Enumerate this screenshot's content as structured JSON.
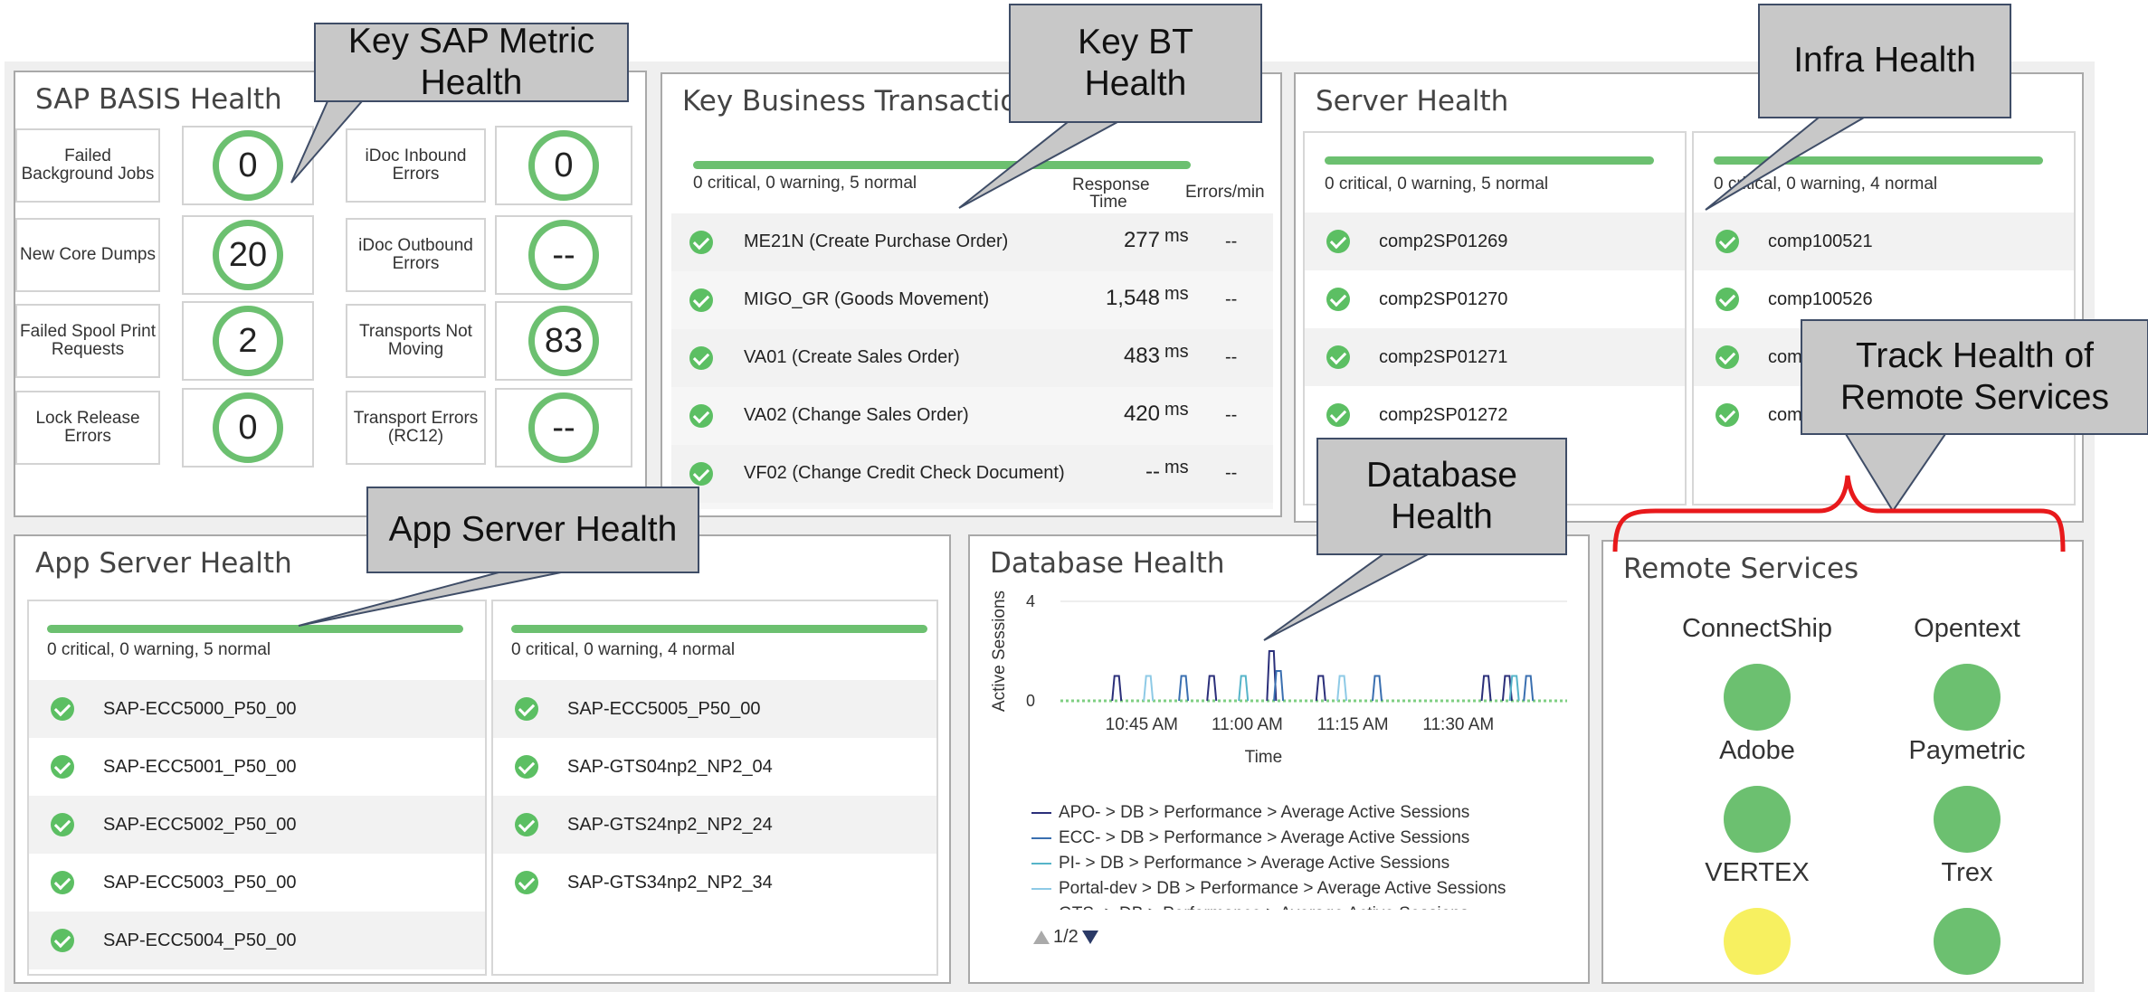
{
  "basis": {
    "title": "SAP BASIS Health",
    "metrics_left": [
      {
        "label": "Failed Background Jobs",
        "value": "0"
      },
      {
        "label": "New Core Dumps",
        "value": "20"
      },
      {
        "label": "Failed Spool Print Requests",
        "value": "2"
      },
      {
        "label": "Lock Release Errors",
        "value": "0"
      }
    ],
    "metrics_right": [
      {
        "label": "iDoc Inbound Errors",
        "value": "0"
      },
      {
        "label": "iDoc Outbound Errors",
        "value": "--"
      },
      {
        "label": "Transports Not Moving",
        "value": "83"
      },
      {
        "label": "Transport Errors (RC12)",
        "value": "--"
      }
    ]
  },
  "bt": {
    "title": "Key Business Transaction H",
    "summary": "0 critical, 0 warning, 5 normal",
    "col_response": "Response Time",
    "col_errors": "Errors/min",
    "rows": [
      {
        "name": "ME21N (Create Purchase Order)",
        "value": "277",
        "unit": "ms",
        "errors": "--"
      },
      {
        "name": "MIGO_GR (Goods Movement)",
        "value": "1,548",
        "unit": "ms",
        "errors": "--"
      },
      {
        "name": "VA01 (Create Sales Order)",
        "value": "483",
        "unit": "ms",
        "errors": "--"
      },
      {
        "name": "VA02 (Change Sales Order)",
        "value": "420",
        "unit": "ms",
        "errors": "--"
      },
      {
        "name": "VF02 (Change Credit Check Document)",
        "value": "--",
        "unit": "ms",
        "errors": "--"
      }
    ]
  },
  "server": {
    "title": "Server Health",
    "left_summary": "0 critical, 0 warning, 5 normal",
    "left_rows": [
      "comp2SP01269",
      "comp2SP01270",
      "comp2SP01271",
      "comp2SP01272"
    ],
    "right_summary": "0 critical, 0 warning, 4 normal",
    "right_rows": [
      "comp100521",
      "comp100526",
      "comp",
      "comp"
    ]
  },
  "app": {
    "title": "App Server Health",
    "left_summary": "0 critical, 0 warning, 5 normal",
    "left_rows": [
      "SAP-ECC5000_P50_00",
      "SAP-ECC5001_P50_00",
      "SAP-ECC5002_P50_00",
      "SAP-ECC5003_P50_00",
      "SAP-ECC5004_P50_00"
    ],
    "right_summary": "0 critical, 0 warning, 4 normal",
    "right_rows": [
      "SAP-ECC5005_P50_00",
      "SAP-GTS04np2_NP2_04",
      "SAP-GTS24np2_NP2_24",
      "SAP-GTS34np2_NP2_34"
    ]
  },
  "db": {
    "title": "Database Health",
    "legend": [
      "APO- > DB > Performance > Average Active Sessions",
      "ECC- > DB > Performance > Average Active Sessions",
      "PI- > DB > Performance > Average Active Sessions",
      "Portal-dev > DB > Performance > Average Active Sessions",
      "GTS- > DB > Performance > Average Active Sessions"
    ],
    "pager": "1/2",
    "colors": [
      "#2b2f7a",
      "#3a6fb0",
      "#56b4c9",
      "#8ecae6",
      "#b9dce8"
    ]
  },
  "chart_data": {
    "type": "line",
    "xlabel": "Time",
    "ylabel": "Active Sessions",
    "x_ticks": [
      "10:45 AM",
      "11:00 AM",
      "11:15 AM",
      "11:30 AM"
    ],
    "y_ticks": [
      "0",
      "4"
    ],
    "ylim": [
      0,
      4
    ],
    "xlim_minutes": [
      35,
      107
    ],
    "spikes": [
      {
        "series": 0,
        "t": 43,
        "v": 1.0
      },
      {
        "series": 3,
        "t": 47.5,
        "v": 1.0
      },
      {
        "series": 1,
        "t": 52.5,
        "v": 1.0
      },
      {
        "series": 0,
        "t": 56.5,
        "v": 1.0
      },
      {
        "series": 2,
        "t": 61,
        "v": 1.0
      },
      {
        "series": 0,
        "t": 65,
        "v": 2.0
      },
      {
        "series": 1,
        "t": 66,
        "v": 1.2
      },
      {
        "series": 0,
        "t": 72,
        "v": 1.0
      },
      {
        "series": 3,
        "t": 75,
        "v": 1.0
      },
      {
        "series": 1,
        "t": 80,
        "v": 1.0
      },
      {
        "series": 0,
        "t": 95.5,
        "v": 1.0
      },
      {
        "series": 0,
        "t": 98.5,
        "v": 1.0
      },
      {
        "series": 2,
        "t": 99.5,
        "v": 1.0
      },
      {
        "series": 1,
        "t": 101.5,
        "v": 1.0
      }
    ]
  },
  "remote": {
    "title": "Remote Services",
    "services": [
      {
        "name": "ConnectShip",
        "color": "#6cc070"
      },
      {
        "name": "Opentext",
        "color": "#6cc070"
      },
      {
        "name": "Adobe",
        "color": "#6cc070"
      },
      {
        "name": "Paymetric",
        "color": "#6cc070"
      },
      {
        "name": "VERTEX",
        "color": "#f7f060"
      },
      {
        "name": "Trex",
        "color": "#6cc070"
      }
    ]
  },
  "callouts": {
    "sap_metric": "Key SAP Metric Health",
    "bt": "Key BT Health",
    "infra": "Infra Health",
    "remote": "Track Health of Remote Services",
    "database": "Database Health",
    "app_server": "App Server Health"
  }
}
